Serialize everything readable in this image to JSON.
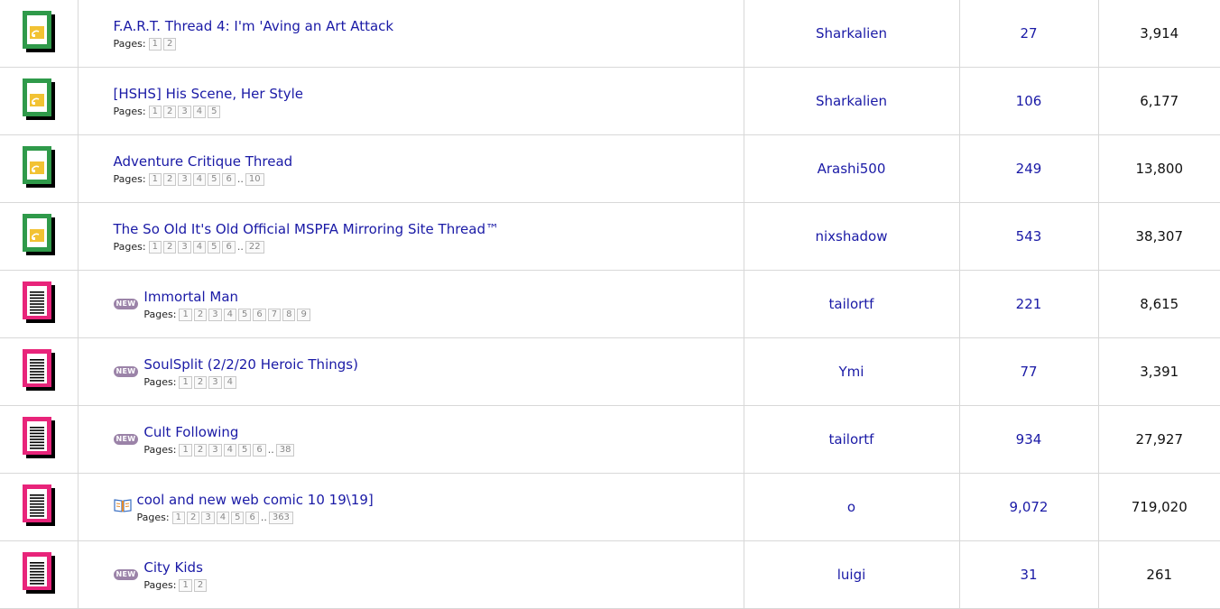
{
  "threads": [
    {
      "title": "F.A.R.T. Thread 4: I'm 'Aving an Art Attack",
      "icon": "sticky-thread-icon",
      "prefix": "",
      "pages_label": "Pages:",
      "pages": [
        "1",
        "2"
      ],
      "last_page": "",
      "author": "Sharkalien",
      "replies": "27",
      "views": "3,914"
    },
    {
      "title": "[HSHS] His Scene, Her Style",
      "icon": "sticky-thread-icon",
      "prefix": "",
      "pages_label": "Pages:",
      "pages": [
        "1",
        "2",
        "3",
        "4",
        "5"
      ],
      "last_page": "",
      "author": "Sharkalien",
      "replies": "106",
      "views": "6,177"
    },
    {
      "title": "Adventure Critique Thread",
      "icon": "sticky-thread-icon",
      "prefix": "",
      "pages_label": "Pages:",
      "pages": [
        "1",
        "2",
        "3",
        "4",
        "5",
        "6"
      ],
      "last_page": "10",
      "author": "Arashi500",
      "replies": "249",
      "views": "13,800"
    },
    {
      "title": "The So Old It's Old Official MSPFA Mirroring Site Thread™",
      "icon": "sticky-thread-icon",
      "prefix": "",
      "pages_label": "Pages:",
      "pages": [
        "1",
        "2",
        "3",
        "4",
        "5",
        "6"
      ],
      "last_page": "22",
      "author": "nixshadow",
      "replies": "543",
      "views": "38,307"
    },
    {
      "title": "Immortal Man",
      "icon": "hot-thread-icon",
      "prefix": "NEW",
      "pages_label": "Pages:",
      "pages": [
        "1",
        "2",
        "3",
        "4",
        "5",
        "6",
        "7",
        "8",
        "9"
      ],
      "last_page": "",
      "author": "tailortf",
      "replies": "221",
      "views": "8,615"
    },
    {
      "title": "SoulSplit (2/2/20 Heroic Things)",
      "icon": "hot-thread-icon",
      "prefix": "NEW",
      "pages_label": "Pages:",
      "pages": [
        "1",
        "2",
        "3",
        "4"
      ],
      "last_page": "",
      "author": "Ymi",
      "replies": "77",
      "views": "3,391"
    },
    {
      "title": "Cult Following",
      "icon": "hot-thread-icon",
      "prefix": "NEW",
      "pages_label": "Pages:",
      "pages": [
        "1",
        "2",
        "3",
        "4",
        "5",
        "6"
      ],
      "last_page": "38",
      "author": "tailortf",
      "replies": "934",
      "views": "27,927"
    },
    {
      "title": "cool and new web comic 10 19\\19]",
      "icon": "hot-thread-icon",
      "prefix": "book",
      "pages_label": "Pages:",
      "pages": [
        "1",
        "2",
        "3",
        "4",
        "5",
        "6"
      ],
      "last_page": "363",
      "author": "o",
      "replies": "9,072",
      "views": "719,020"
    },
    {
      "title": "City Kids",
      "icon": "hot-thread-icon",
      "prefix": "NEW",
      "pages_label": "Pages:",
      "pages": [
        "1",
        "2"
      ],
      "last_page": "",
      "author": "luigi",
      "replies": "31",
      "views": "261"
    }
  ],
  "ellipsis": "..",
  "colors": {
    "link": "#1a1aa6",
    "sticky_icon": "#2f9a4a",
    "hot_icon": "#e8247a",
    "badge": "#9b83a8"
  }
}
